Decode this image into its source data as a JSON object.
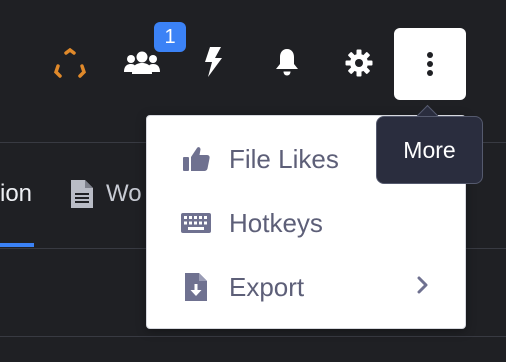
{
  "toolbar": {
    "icons": {
      "logo": "logo-icon",
      "team": "users-icon",
      "bolt": "lightning-icon",
      "bell": "bell-icon",
      "settings": "gear-icon",
      "more": "more-vertical-icon"
    },
    "team_badge": "1",
    "colors": {
      "logo": "#e0892a",
      "badge": "#3b82f6",
      "background": "#1f2024"
    }
  },
  "tabs": {
    "left_partial": "ion",
    "second_partial": "Wo"
  },
  "menu": {
    "items": [
      {
        "label": "File Likes",
        "icon": "thumbs-up-icon"
      },
      {
        "label": "Hotkeys",
        "icon": "keyboard-icon"
      },
      {
        "label": "Export",
        "icon": "file-download-icon",
        "submenu": true
      }
    ]
  },
  "tooltip": {
    "text": "More"
  }
}
